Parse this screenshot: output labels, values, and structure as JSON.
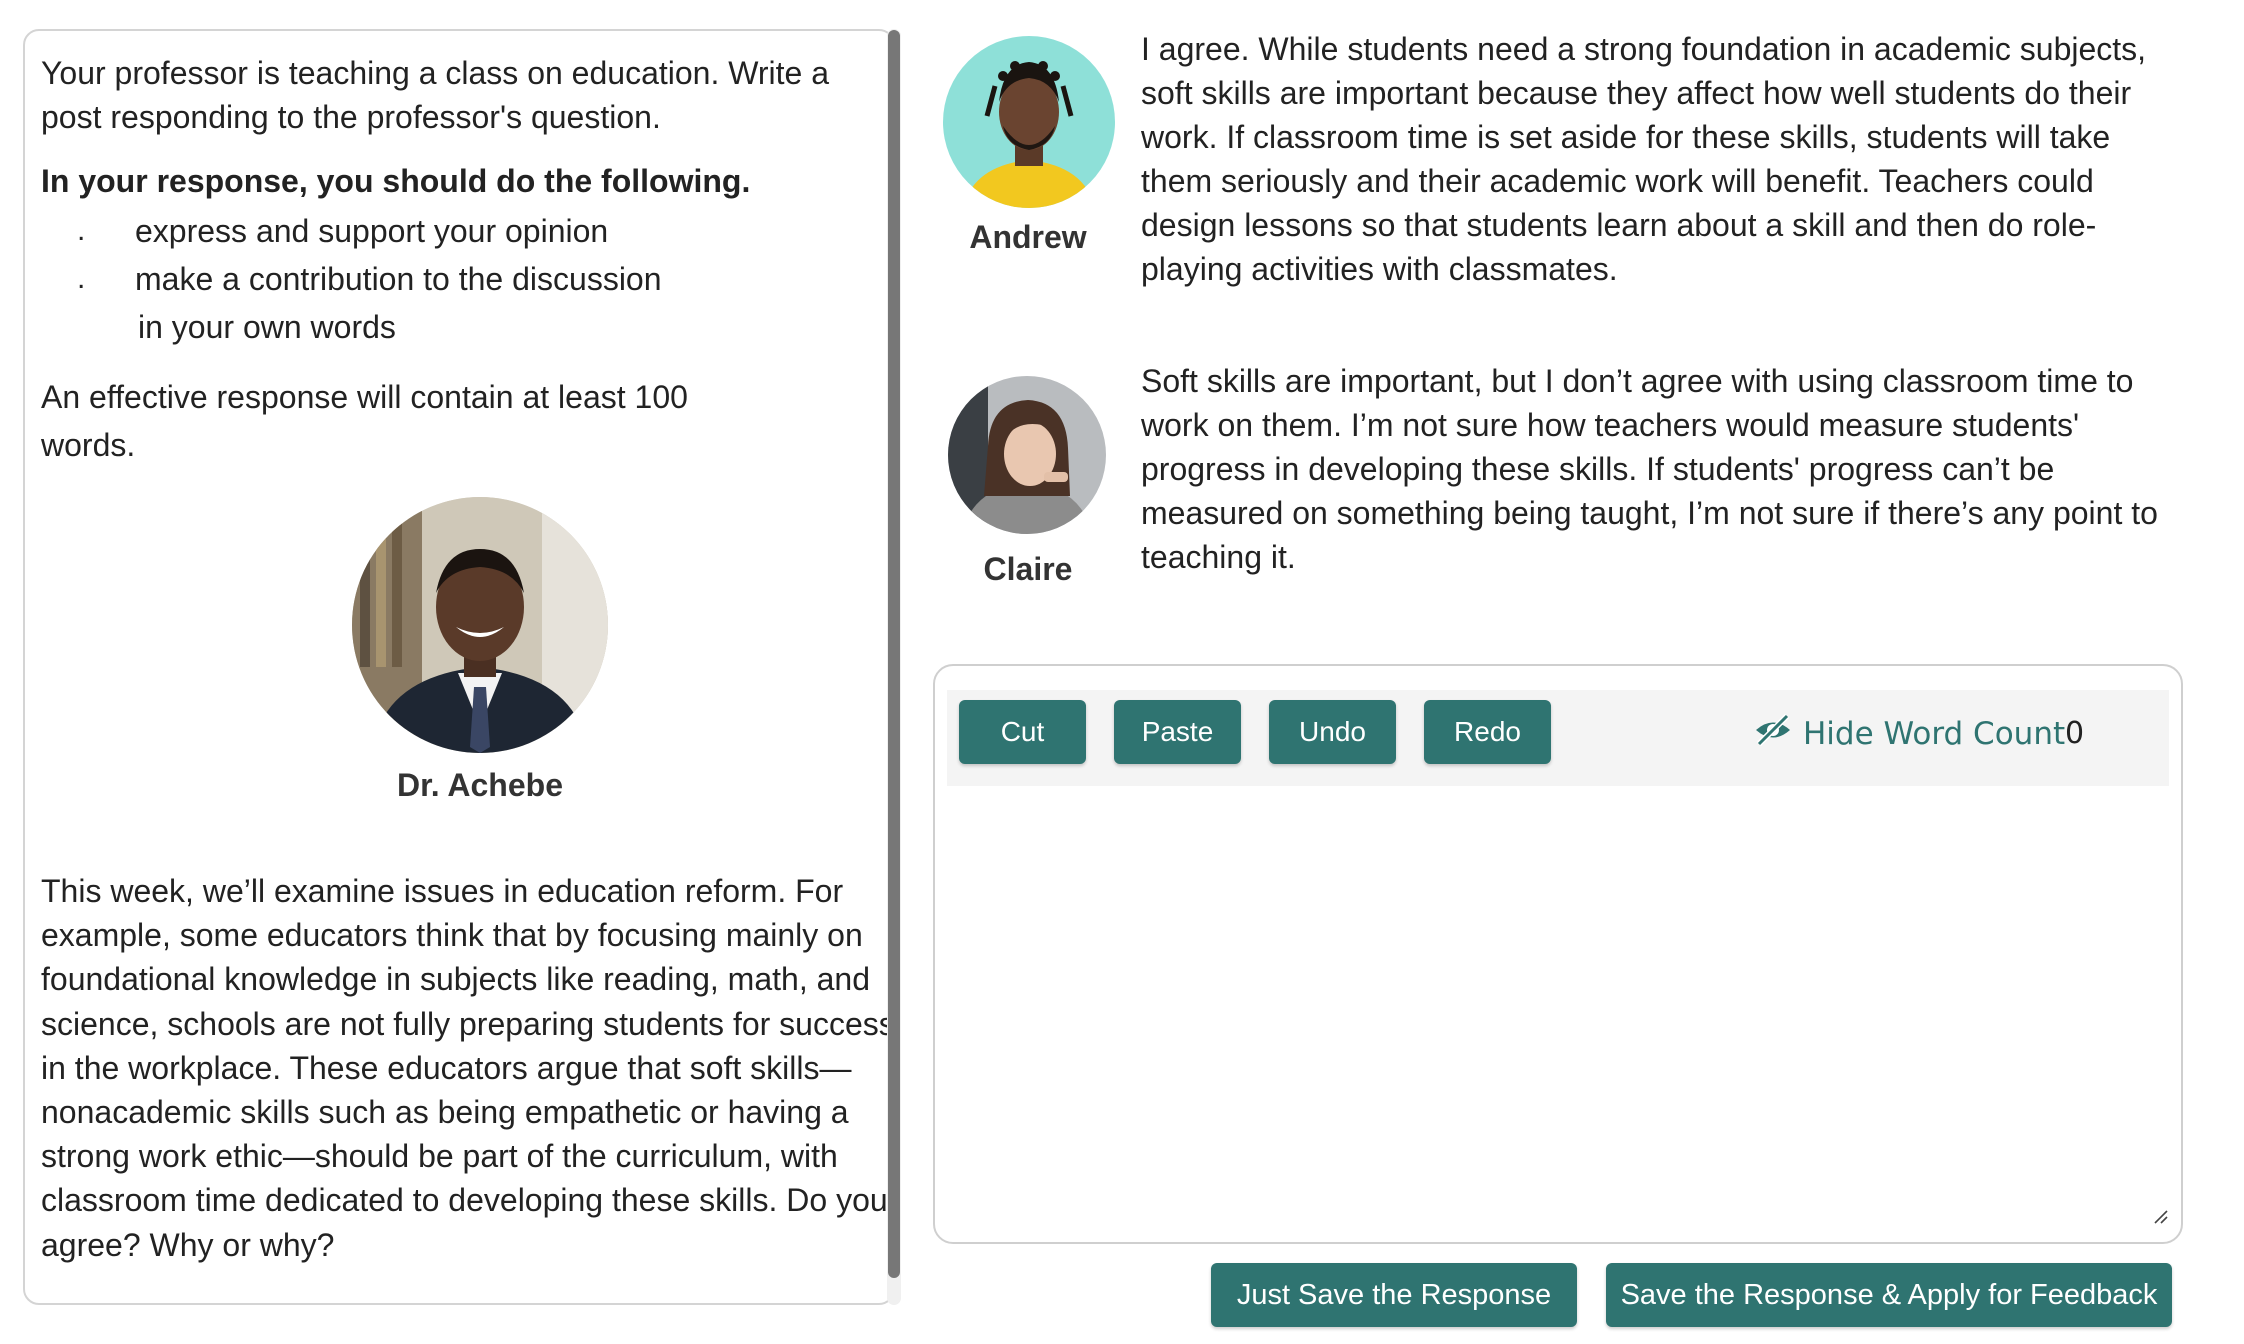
{
  "prompt": {
    "intro": "Your professor is teaching a class on education. Write a post responding to the professor's question.",
    "requirements_title": "In your response, you should do the following.",
    "bullets": [
      "express and support your opinion",
      "make a contribution to the discussion"
    ],
    "bullet_extra": "in your own words",
    "bullet_marker": ".",
    "effective_note": "An effective response will contain at least 100 words."
  },
  "professor": {
    "name": "Dr. Achebe",
    "question": "This week, we’ll examine issues in education reform. For example, some educators think that by focusing mainly on foundational knowledge in subjects like reading, math, and science, schools are not fully preparing students for success in the workplace. These educators argue that soft skills—nonacademic skills such as being empathetic or having a strong work ethic—should be part of the curriculum, with classroom time dedicated to developing these skills. Do you agree? Why or why?"
  },
  "peers": [
    {
      "name": "Andrew",
      "post": "I agree. While students need a strong foundation in academic subjects, soft skills are important because they affect how well students do their work. If classroom time is set aside for these skills, students will take them seriously and their academic work will benefit. Teachers could design lessons so that students learn about a skill and then do role-playing activities with classmates."
    },
    {
      "name": "Claire",
      "post": "Soft skills are important, but I don’t agree with using classroom time to work on them. I’m not sure how teachers would measure students' progress in developing these skills. If students' progress can’t be measured on something being taught, I’m not sure if there’s any point to teaching it."
    }
  ],
  "editor": {
    "toolbar": {
      "cut": "Cut",
      "paste": "Paste",
      "undo": "Undo",
      "redo": "Redo"
    },
    "word_count_toggle": "Hide Word Count",
    "word_count": "0",
    "response_value": ""
  },
  "actions": {
    "save": "Just Save the Response",
    "save_feedback": "Save the Response & Apply for Feedback"
  },
  "colors": {
    "accent": "#2f7471",
    "panel_border": "#d4d4d4",
    "scrollbar": "#777777"
  }
}
